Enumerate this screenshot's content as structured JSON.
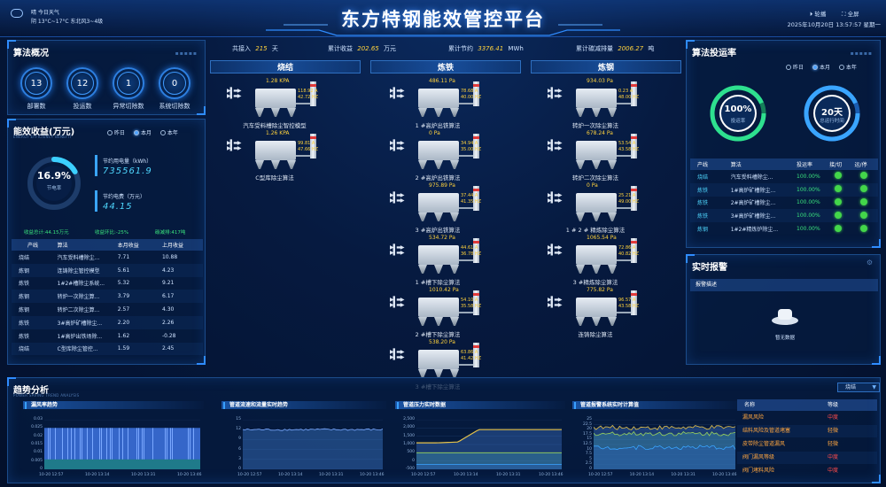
{
  "header": {
    "title": "东方特钢能效管控平台",
    "weather_line1": "晴 今日天气",
    "weather_line2": "阴 13°C~17°C 东北风3~4级",
    "carousel_label": "轮播",
    "fullscreen_label": "全屏",
    "datetime": "2025年10月20日 13:57:57 星期一"
  },
  "top_stats": {
    "run_prefix": "共接入",
    "run_value": "215",
    "run_unit": "天",
    "income_prefix": "累计收益",
    "income_value": "202.65",
    "income_unit": "万元",
    "save_prefix": "累计节约",
    "save_value": "3376.41",
    "save_unit": "MWh",
    "carbon_prefix": "累计碳减排量",
    "carbon_value": "2006.27",
    "carbon_unit": "吨"
  },
  "algo_overview": {
    "title": "算法概况",
    "items": [
      {
        "value": "13",
        "label": "部署数"
      },
      {
        "value": "12",
        "label": "投运数"
      },
      {
        "value": "1",
        "label": "异常切除数"
      },
      {
        "value": "0",
        "label": "系统切除数"
      }
    ]
  },
  "energy": {
    "title": "能效收益(万元)",
    "subtitle": "ENERGY EFFICIENCY BENEFIT",
    "options": [
      "昨日",
      "本月",
      "本年"
    ],
    "ring_value": "16.9%",
    "ring_label": "节电率",
    "power_label": "节约用电量（kWh）",
    "power_value": "735561.9",
    "fee_label": "节约电费（万元）",
    "fee_value": "44.15",
    "summary_total": "收益总计:44.15万元",
    "summary_ratio": "收益环比:-25%",
    "summary_carbon": "碳减排:417吨",
    "table_headers": [
      "产线",
      "算法",
      "本月收益",
      "上月收益"
    ],
    "table_rows": [
      [
        "烧结",
        "汽车受料槽除尘...",
        "7.71",
        "10.88"
      ],
      [
        "炼钢",
        "连铸除尘管控模型",
        "5.61",
        "4.23"
      ],
      [
        "炼铁",
        "1#2#槽除尘系统...",
        "5.32",
        "9.21"
      ],
      [
        "炼钢",
        "转炉一次除尘算...",
        "3.79",
        "6.17"
      ],
      [
        "炼钢",
        "转炉二次除尘算...",
        "2.57",
        "4.30"
      ],
      [
        "炼铁",
        "3#高炉矿槽除尘...",
        "2.20",
        "2.26"
      ],
      [
        "炼铁",
        "1#高炉出铁场除...",
        "1.62",
        "-0.28"
      ],
      [
        "烧结",
        "C型库除尘管控...",
        "1.59",
        "2.45"
      ]
    ]
  },
  "process": {
    "segments": [
      "烧结",
      "炼铁",
      "炼钢"
    ],
    "col1": [
      {
        "pv": "1.28 KPA",
        "a": "118.92 A",
        "hz": "42.72 HZ",
        "name": "汽车受料槽除尘智控模型"
      },
      {
        "pv": "1.26 KPA",
        "a": "99.81 A",
        "hz": "47.66 HZ",
        "name": "C型库除尘算法"
      }
    ],
    "col2": [
      {
        "pv": "486.11 Pa",
        "a": "78.68 A",
        "hz": "40.00 HZ",
        "name": "1 #高炉出铁算法"
      },
      {
        "pv": "0 Pa",
        "a": "34.94 A",
        "hz": "35.00 HZ",
        "name": "2 #高炉出铁算法"
      },
      {
        "pv": "975.89 Pa",
        "a": "37.44 A",
        "hz": "41.35 HZ",
        "name": "3 #高炉出铁算法"
      },
      {
        "pv": "534.72 Pa",
        "a": "44.61 A",
        "hz": "36.78 HZ",
        "name": "1 #槽下除尘算法"
      },
      {
        "pv": "1010.42 Pa",
        "a": "54.10 A",
        "hz": "35.58 HZ",
        "name": "2 #槽下除尘算法"
      },
      {
        "pv": "538.20 Pa",
        "a": "63.86 A",
        "hz": "41.42 HZ",
        "name": "3 #槽下除尘算法"
      }
    ],
    "col3": [
      {
        "pv": "934.03 Pa",
        "a": "0.23 A",
        "hz": "48.00 HZ",
        "name": "转炉一次除尘算法"
      },
      {
        "pv": "678.24 Pa",
        "a": "53.54 A",
        "hz": "43.58 HZ",
        "name": "转炉二次除尘算法"
      },
      {
        "pv": "0 Pa",
        "a": "25.21 A",
        "hz": "49.00 HZ",
        "name": "1 # 2 # 精炼除尘算法"
      },
      {
        "pv": "1065.54 Pa",
        "a": "72.86 A",
        "hz": "40.82 HZ",
        "name": "3 #精炼除尘算法"
      },
      {
        "pv": "775.82 Pa",
        "a": "96.57 A",
        "hz": "43.58 HZ",
        "name": "连铸除尘算法"
      }
    ]
  },
  "algo_rate": {
    "title": "算法投运率",
    "options": [
      "昨日",
      "本月",
      "本年"
    ],
    "ring1_value": "100%",
    "ring1_label": "投运率",
    "ring2_value": "20天",
    "ring2_label": "总运行时间",
    "table_headers": [
      "产线",
      "算法",
      "投运率",
      "接/切",
      "运/停"
    ],
    "table_rows": [
      [
        "烧结",
        "汽车受料槽除尘...",
        "100.00%"
      ],
      [
        "炼铁",
        "1#高炉矿槽除尘...",
        "100.00%"
      ],
      [
        "炼铁",
        "2#高炉矿槽除尘...",
        "100.00%"
      ],
      [
        "炼铁",
        "3#高炉矿槽除尘...",
        "100.00%"
      ],
      [
        "炼钢",
        "1#2#精炼炉除尘...",
        "100.00%"
      ]
    ]
  },
  "alarm": {
    "title": "实时报警",
    "header": "报警描述",
    "empty": "暂无数据"
  },
  "trend": {
    "title": "趋势分析",
    "subtitle": "POWER SAVING TREND ANALYSIS",
    "select": "烧结",
    "chart_titles": [
      "漏风率趋势",
      "管道流速和流量实时趋势",
      "管道压力实时数据",
      "管道报警系统实时计算值"
    ],
    "list_header_name": "名称",
    "list_header_level": "等级",
    "list": [
      {
        "name": "漏风风险",
        "level": "中度"
      },
      {
        "name": "结料风险及管道堵塞",
        "level": "轻微"
      },
      {
        "name": "皮带除尘管道漏风",
        "level": "轻微"
      },
      {
        "name": "阀门漏风等级",
        "level": "中度"
      },
      {
        "name": "阀门堵料风险",
        "level": "中度"
      }
    ]
  },
  "chart_data": [
    {
      "type": "bar",
      "title": "漏风率趋势",
      "ylim": [
        0,
        0.03
      ],
      "yticks": [
        "0.03",
        "0.025",
        "0.02",
        "0.015",
        "0.01",
        "0.005",
        "0"
      ],
      "x": [
        "10-20 12:57",
        "10-20 13:14",
        "10-20 13:31",
        "10-20 13:46"
      ],
      "values": [
        0.025
      ]
    },
    {
      "type": "line",
      "title": "管道流速和流量实时趋势",
      "ylim": [
        0,
        15
      ],
      "yticks": [
        "15",
        "12",
        "9",
        "6",
        "3",
        "0"
      ],
      "x": [
        "10-20 12:57",
        "10-20 13:14",
        "10-20 13:31",
        "10-20 13:46"
      ],
      "values": [
        12,
        12
      ]
    },
    {
      "type": "line",
      "title": "管道压力实时数据",
      "ylim": [
        -500,
        2500
      ],
      "yticks": [
        "2,500",
        "2,000",
        "1,500",
        "1,000",
        "500",
        "0",
        "-500"
      ],
      "x": [
        "10-20 12:57",
        "10-20 13:14",
        "10-20 13:31",
        "10-20 13:46"
      ],
      "series": [
        {
          "values": [
            1100,
            1100,
            1150,
            1900,
            1900,
            1900,
            1900,
            1900
          ]
        },
        {
          "values": [
            500,
            500,
            500,
            500,
            500,
            500,
            500,
            500
          ]
        },
        {
          "values": [
            -200,
            -200,
            -200,
            -200,
            -200,
            -200,
            -200,
            -200
          ]
        }
      ]
    },
    {
      "type": "line",
      "title": "管道报警系统实时计算值",
      "ylim": [
        0,
        25
      ],
      "yticks": [
        "25",
        "22.5",
        "20",
        "17.5",
        "15",
        "12.5",
        "10",
        "7.5",
        "5",
        "2.5",
        "0"
      ],
      "x": [
        "10-20 12:57",
        "10-20 13:14",
        "10-20 13:31",
        "10-20 13:46"
      ],
      "series": [
        {
          "values": [
            21,
            21
          ]
        },
        {
          "values": [
            18,
            18
          ]
        },
        {
          "values": [
            11,
            11
          ]
        }
      ]
    }
  ]
}
